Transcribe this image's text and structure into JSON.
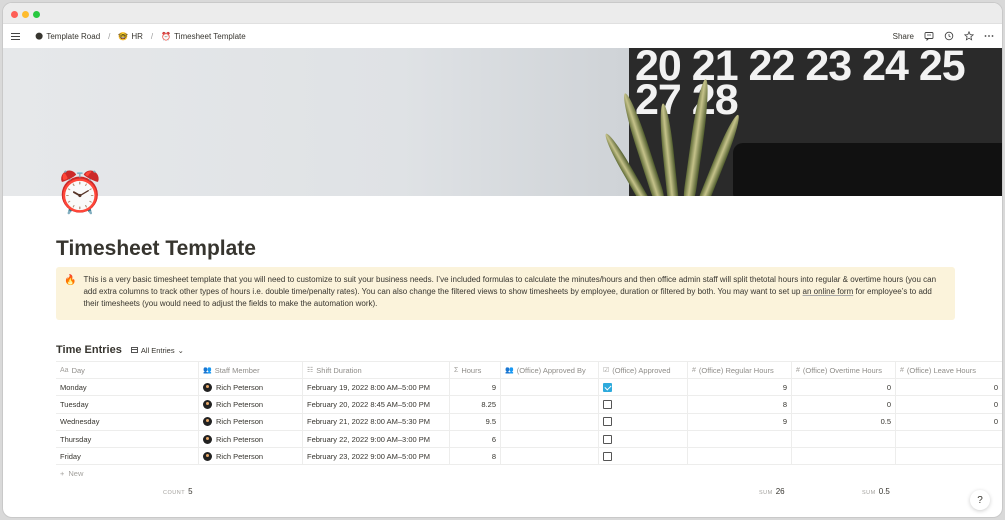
{
  "breadcrumb": {
    "items": [
      {
        "emoji": "🌑",
        "label": "Template Road"
      },
      {
        "emoji": "🤓",
        "label": "HR"
      },
      {
        "emoji": "⏰",
        "label": "Timesheet Template"
      }
    ],
    "separator": "/"
  },
  "topbar": {
    "share_label": "Share"
  },
  "cover": {
    "calendar_row1": "20 21 22 23 24 25",
    "calendar_row2": "27 28"
  },
  "page": {
    "icon": "⏰",
    "title": "Timesheet Template"
  },
  "callout": {
    "emoji": "🔥",
    "text_before_link": "This is a very basic timesheet template that you will need to customize to suit your business needs. I’ve included formulas to calculate the minutes/hours and then office admin staff will split thetotal hours into regular & overtime hours (you can add extra columns to track other types of hours i.e. double time/penalty rates). You can also change the filtered views to show timesheets by employee, duration or filtered by both. You may want to set up",
    "link_text": "an online form",
    "text_after_link": "for employee’s to add their timesheets (you would need to adjust the fields to make the automation work)."
  },
  "database": {
    "title": "Time Entries",
    "view_label": "All Entries",
    "columns": [
      {
        "icon": "Aa",
        "label": "Day"
      },
      {
        "icon": "👥",
        "label": "Staff Member"
      },
      {
        "icon": "☷",
        "label": "Shift Duration"
      },
      {
        "icon": "Σ",
        "label": "Hours"
      },
      {
        "icon": "👥",
        "label": "(Office) Approved By"
      },
      {
        "icon": "☑",
        "label": "(Office) Approved"
      },
      {
        "icon": "#",
        "label": "(Office) Regular Hours"
      },
      {
        "icon": "#",
        "label": "(Office) Overtime Hours"
      },
      {
        "icon": "#",
        "label": "(Office) Leave Hours"
      }
    ],
    "rows": [
      {
        "day": "Monday",
        "staff": "Rich Peterson",
        "shift": "February 19, 2022 8:00 AM–5:00 PM",
        "hours": "9",
        "approved_by": "",
        "approved": true,
        "regular": "9",
        "overtime": "0",
        "leave": "0"
      },
      {
        "day": "Tuesday",
        "staff": "Rich Peterson",
        "shift": "February 20, 2022 8:45 AM–5:00 PM",
        "hours": "8.25",
        "approved_by": "",
        "approved": false,
        "regular": "8",
        "overtime": "0",
        "leave": "0"
      },
      {
        "day": "Wednesday",
        "staff": "Rich Peterson",
        "shift": "February 21, 2022 8:00 AM–5:30 PM",
        "hours": "9.5",
        "approved_by": "",
        "approved": false,
        "regular": "9",
        "overtime": "0.5",
        "leave": "0"
      },
      {
        "day": "Thursday",
        "staff": "Rich Peterson",
        "shift": "February 22, 2022 9:00 AM–3:00 PM",
        "hours": "6",
        "approved_by": "",
        "approved": false,
        "regular": "",
        "overtime": "",
        "leave": ""
      },
      {
        "day": "Friday",
        "staff": "Rich Peterson",
        "shift": "February 23, 2022 9:00 AM–5:00 PM",
        "hours": "8",
        "approved_by": "",
        "approved": false,
        "regular": "",
        "overtime": "",
        "leave": ""
      }
    ],
    "new_label": "New",
    "summaries": {
      "count": {
        "label": "COUNT",
        "value": "5"
      },
      "regular_sum": {
        "label": "SUM",
        "value": "26"
      },
      "overtime_sum": {
        "label": "SUM",
        "value": "0.5"
      }
    }
  },
  "help": {
    "label": "?"
  }
}
